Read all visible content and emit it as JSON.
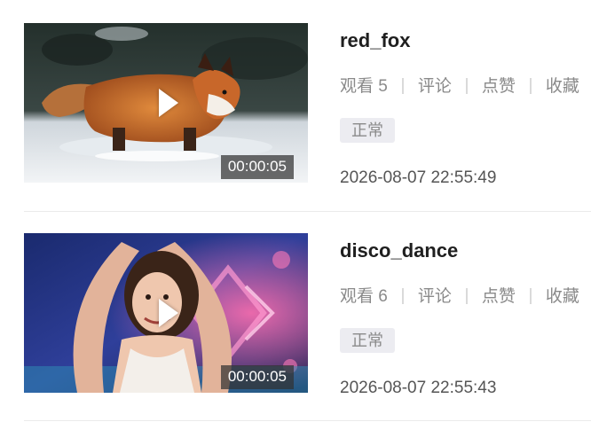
{
  "videos": [
    {
      "title": "red_fox",
      "views": "观看 5",
      "comments": "评论",
      "likes": "点赞",
      "favorites": "收藏",
      "status": "正常",
      "duration": "00:00:05",
      "timestamp": "2026-08-07 22:55:49",
      "thumbnail": "red fox running in snow"
    },
    {
      "title": "disco_dance",
      "views": "观看 6",
      "comments": "评论",
      "likes": "点赞",
      "favorites": "收藏",
      "status": "正常",
      "duration": "00:00:05",
      "timestamp": "2026-08-07 22:55:43",
      "thumbnail": "woman dancing under neon stage lights"
    }
  ],
  "colors": {
    "title": "#1f1f1f",
    "meta_text": "#8a8a8a",
    "badge_bg": "#ececf1",
    "divider": "#ebebeb"
  },
  "icons": [
    "play-icon",
    "play-icon"
  ]
}
